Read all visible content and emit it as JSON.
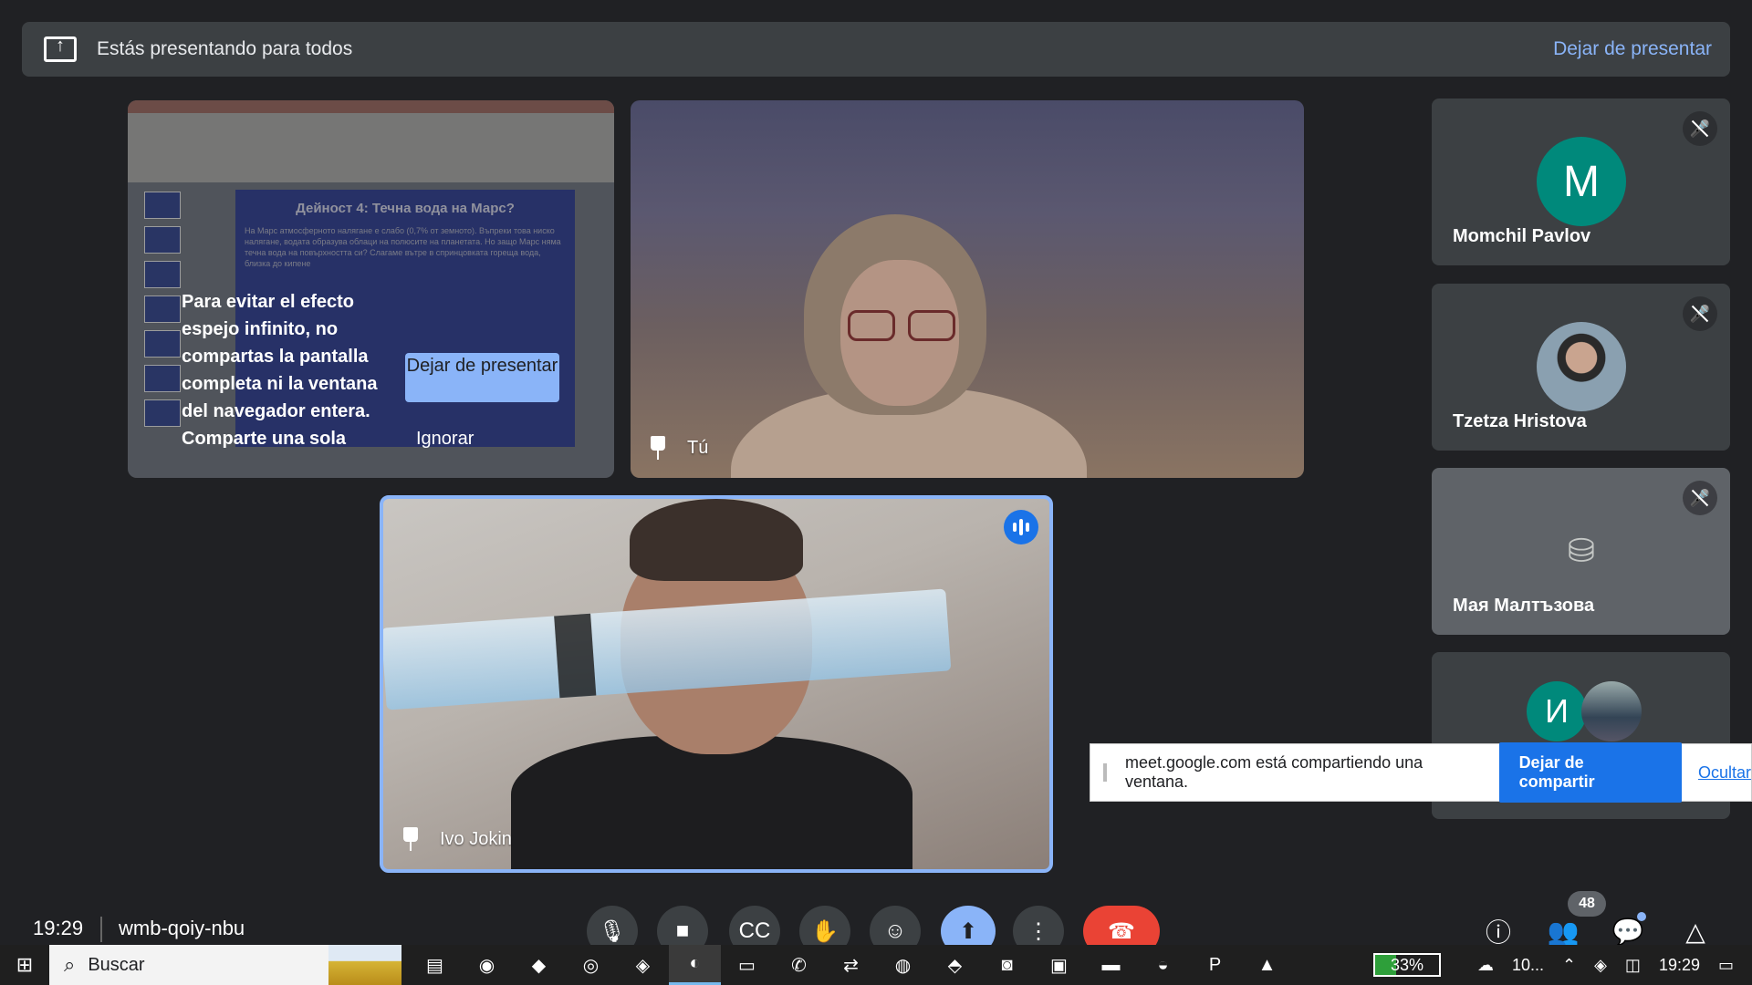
{
  "banner": {
    "text": "Estás presentando para todos",
    "stop_label": "Dejar de presentar"
  },
  "slide_tile": {
    "slide_title": "Дейност 4: Течна вода на Марс?",
    "slide_body": "На Марс атмосферното налягане е слабо (0,7% от земното). Въпреки това ниско налягане, водата образува облаци на полюсите на планетата. Но защо Марс няма течна вода на повърхността си? Слагаме вътре в спринцовката гореща вода, близка до кипене",
    "warning_text": "Para evitar el efecto espejo infinito, no compartas la pantalla completa ni la ventana del navegador entera. Comparte una sola",
    "stop_button": "Dejar de presentar",
    "ignore_button": "Ignorar"
  },
  "you_tile": {
    "name": "Tú"
  },
  "speaker_tile": {
    "name": "Ivo Jokin"
  },
  "participants": [
    {
      "name": "Momchil Pavlov",
      "initial": "M",
      "avatar_color": "#00897b",
      "muted": true
    },
    {
      "name": "Tzetza Hristova",
      "initial": "",
      "avatar_color": "#7a8a9a",
      "muted": true
    },
    {
      "name": "Мая Малтъзова",
      "initial": "",
      "avatar_color": "#5f6368",
      "muted": true
    },
    {
      "name": "",
      "initial": "И",
      "avatar_color": "#00897b",
      "muted": false
    }
  ],
  "sharebar": {
    "text": "meet.google.com está compartiendo una ventana.",
    "stop_label": "Dejar de compartir",
    "hide_label": "Ocultar"
  },
  "meetbar": {
    "time": "19:29",
    "meeting_code": "wmb-qoiy-nbu",
    "participant_count": "48"
  },
  "taskbar": {
    "search_placeholder": "Buscar",
    "battery": "33%",
    "weather": "10...",
    "time": "19:29"
  }
}
